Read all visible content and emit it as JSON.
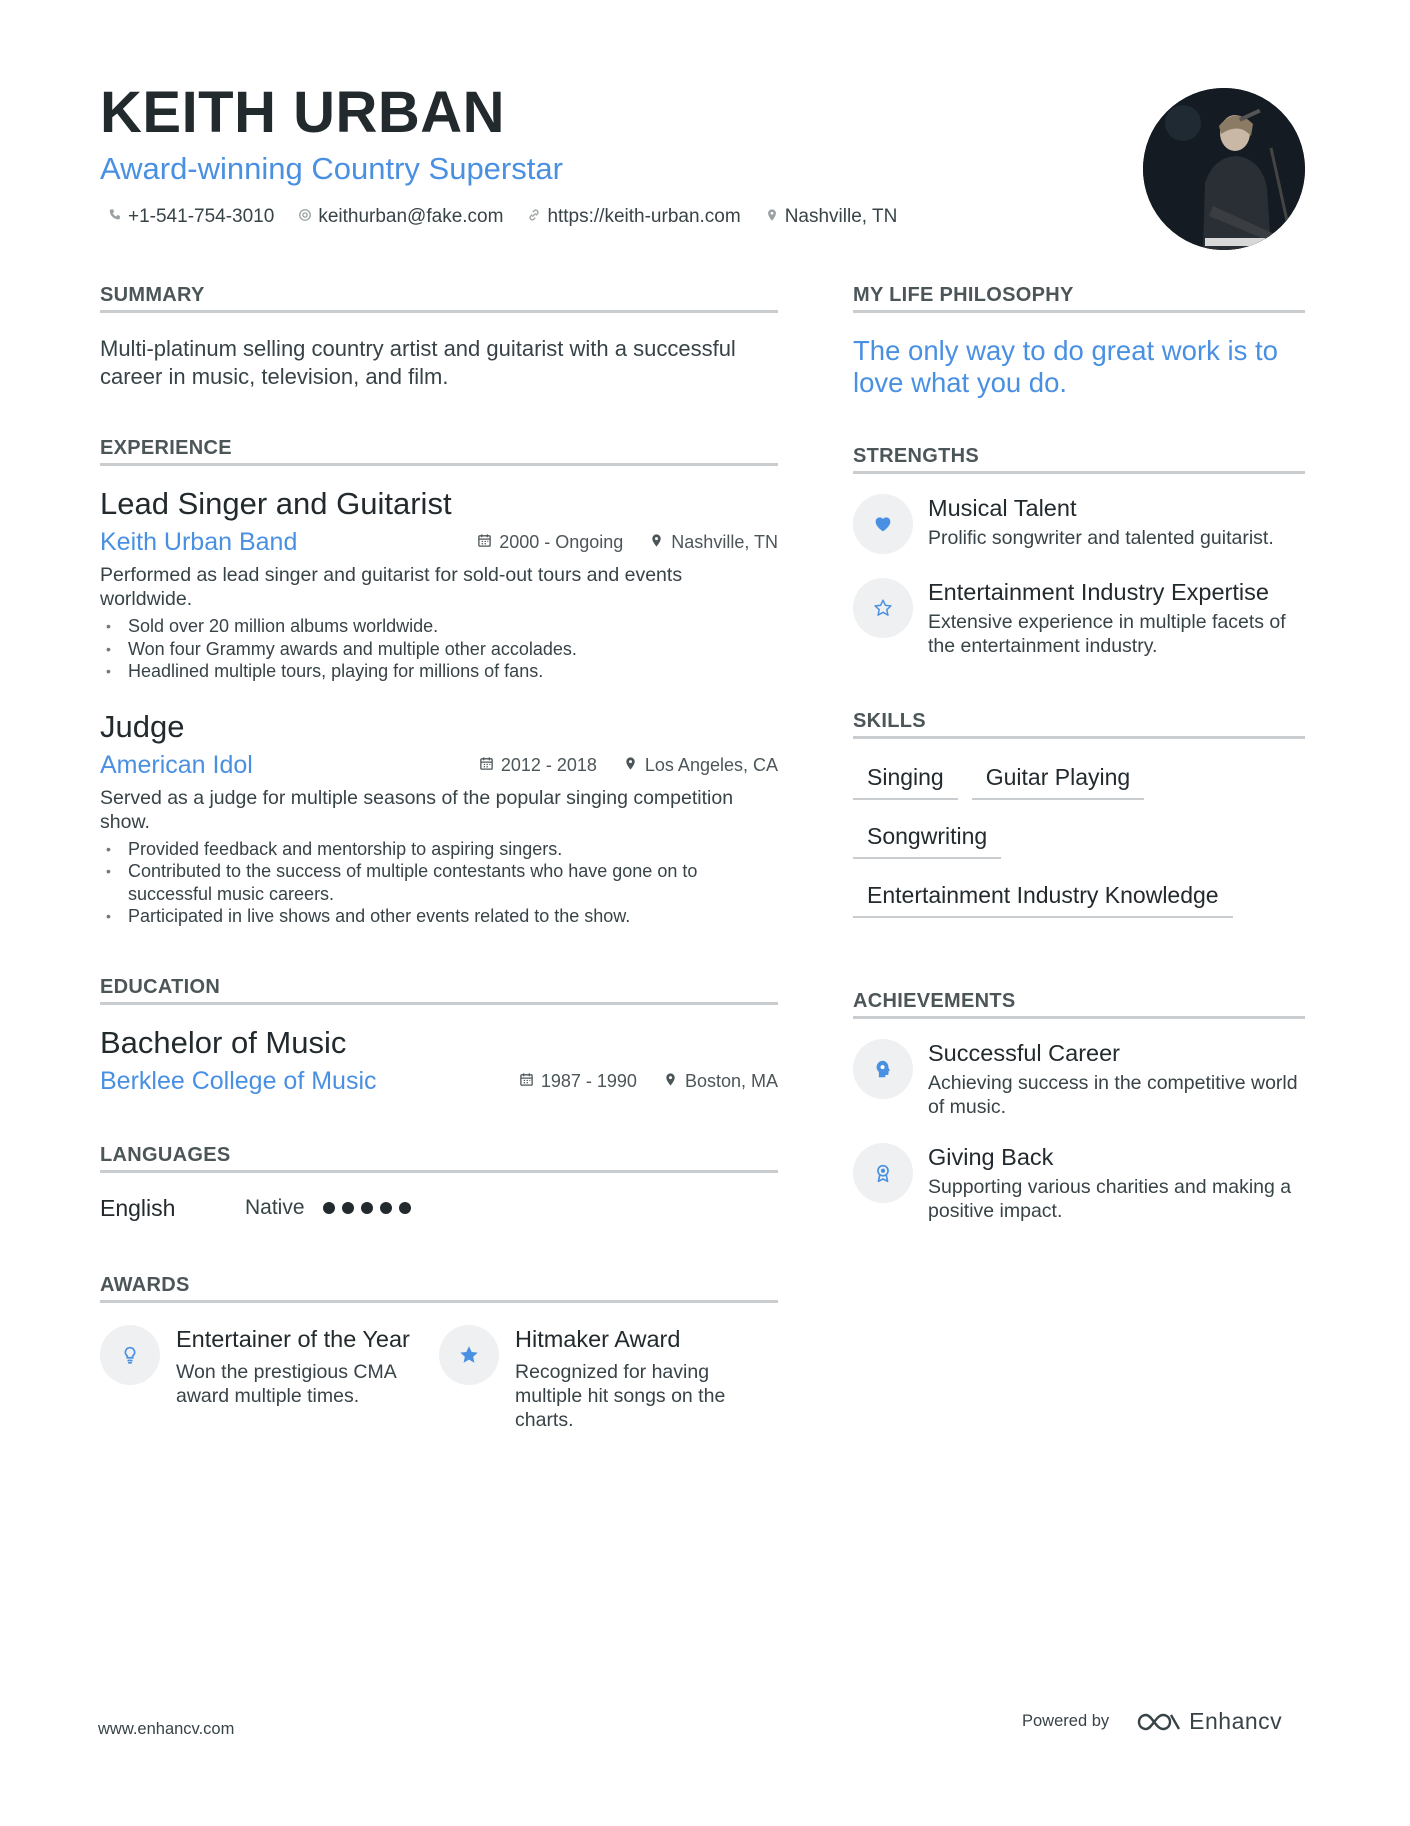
{
  "header": {
    "name": "KEITH URBAN",
    "headline": "Award-winning Country Superstar",
    "phone": "+1-541-754-3010",
    "email": "keithurban@fake.com",
    "website": "https://keith-urban.com",
    "location": "Nashville, TN"
  },
  "summary": {
    "title": "SUMMARY",
    "text": "Multi-platinum selling country artist and guitarist with a successful career in music, television, and film."
  },
  "experience": {
    "title": "EXPERIENCE",
    "items": [
      {
        "role": "Lead Singer and Guitarist",
        "company": "Keith Urban Band",
        "dates": "2000 - Ongoing",
        "location": "Nashville, TN",
        "description": "Performed as lead singer and guitarist for sold-out tours and events worldwide.",
        "bullets": [
          "Sold over 20 million albums worldwide.",
          "Won four Grammy awards and multiple other accolades.",
          "Headlined multiple tours, playing for millions of fans."
        ]
      },
      {
        "role": "Judge",
        "company": "American Idol",
        "dates": "2012 - 2018",
        "location": "Los Angeles, CA",
        "description": "Served as a judge for multiple seasons of the popular singing competition show.",
        "bullets": [
          "Provided feedback and mentorship to aspiring singers.",
          "Contributed to the success of multiple contestants who have gone on to successful music careers.",
          "Participated in live shows and other events related to the show."
        ]
      }
    ]
  },
  "education": {
    "title": "EDUCATION",
    "degree": "Bachelor of Music",
    "school": "Berklee College of Music",
    "dates": "1987 - 1990",
    "location": "Boston, MA"
  },
  "languages": {
    "title": "LANGUAGES",
    "items": [
      {
        "name": "English",
        "level": "Native",
        "rating": 5
      }
    ]
  },
  "awards": {
    "title": "AWARDS",
    "items": [
      {
        "title": "Entertainer of the Year",
        "description": "Won the prestigious CMA award multiple times.",
        "icon": "lightbulb-icon"
      },
      {
        "title": "Hitmaker Award",
        "description": "Recognized for having multiple hit songs on the charts.",
        "icon": "star-icon"
      }
    ]
  },
  "philosophy": {
    "title": "MY LIFE PHILOSOPHY",
    "quote": "The only way to do great work is to love what you do."
  },
  "strengths": {
    "title": "STRENGTHS",
    "items": [
      {
        "title": "Musical Talent",
        "description": "Prolific songwriter and talented guitarist.",
        "icon": "heart-icon"
      },
      {
        "title": "Entertainment Industry Expertise",
        "description": "Extensive experience in multiple facets of the entertainment industry.",
        "icon": "star-outline-icon"
      }
    ]
  },
  "skills": {
    "title": "SKILLS",
    "items": [
      "Singing",
      "Guitar Playing",
      "Songwriting",
      "Entertainment Industry Knowledge"
    ]
  },
  "achievements": {
    "title": "ACHIEVEMENTS",
    "items": [
      {
        "title": "Successful Career",
        "description": "Achieving success in the competitive world of music.",
        "icon": "head-icon"
      },
      {
        "title": "Giving Back",
        "description": "Supporting various charities and making a positive impact.",
        "icon": "ribbon-icon"
      }
    ]
  },
  "footer": {
    "website": "www.enhancv.com",
    "powered_by": "Powered by",
    "brand": "Enhancv"
  },
  "colors": {
    "accent": "#4a90e2",
    "text": "#384347",
    "heading": "#222a2e"
  }
}
